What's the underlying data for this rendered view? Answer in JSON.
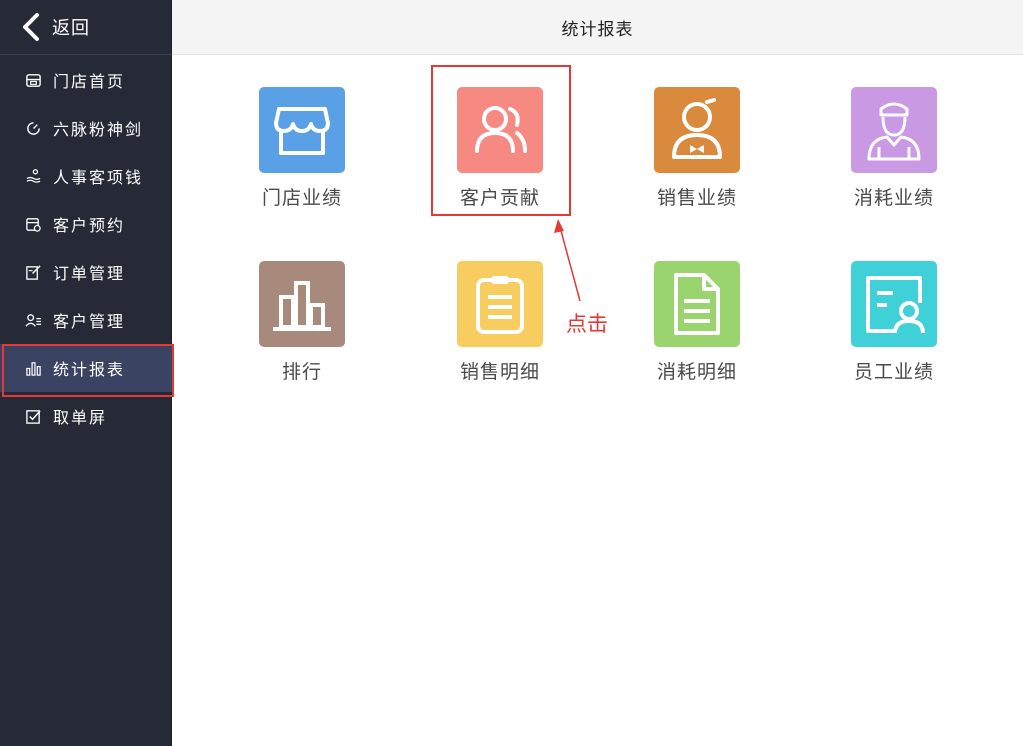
{
  "sidebar": {
    "back_label": "返回",
    "items": [
      {
        "label": "门店首页",
        "icon": "store-icon",
        "active": false
      },
      {
        "label": "六脉粉神剑",
        "icon": "gauge-icon",
        "active": false
      },
      {
        "label": "人事客项钱",
        "icon": "people-money-icon",
        "active": false
      },
      {
        "label": "客户预约",
        "icon": "calendar-icon",
        "active": false
      },
      {
        "label": "订单管理",
        "icon": "order-edit-icon",
        "active": false
      },
      {
        "label": "客户管理",
        "icon": "customer-list-icon",
        "active": false
      },
      {
        "label": "统计报表",
        "icon": "bar-chart-icon",
        "active": true
      },
      {
        "label": "取单屏",
        "icon": "checkbox-icon",
        "active": false
      }
    ]
  },
  "header": {
    "title": "统计报表"
  },
  "reports": [
    {
      "label": "门店业绩",
      "icon": "storefront-icon",
      "color": "#5aa0e6"
    },
    {
      "label": "客户贡献",
      "icon": "customers-icon",
      "color": "#f68a82"
    },
    {
      "label": "销售业绩",
      "icon": "salesperson-icon",
      "color": "#d98a3c"
    },
    {
      "label": "消耗业绩",
      "icon": "worker-icon",
      "color": "#c99ae3"
    },
    {
      "label": "排行",
      "icon": "ranking-bars-icon",
      "color": "#a88a7d"
    },
    {
      "label": "销售明细",
      "icon": "clipboard-icon",
      "color": "#f6cd5e"
    },
    {
      "label": "消耗明细",
      "icon": "document-icon",
      "color": "#9ad46e"
    },
    {
      "label": "员工业绩",
      "icon": "employee-card-icon",
      "color": "#3fd0d8"
    }
  ],
  "annotation": {
    "text": "点击",
    "color": "#e53935"
  }
}
